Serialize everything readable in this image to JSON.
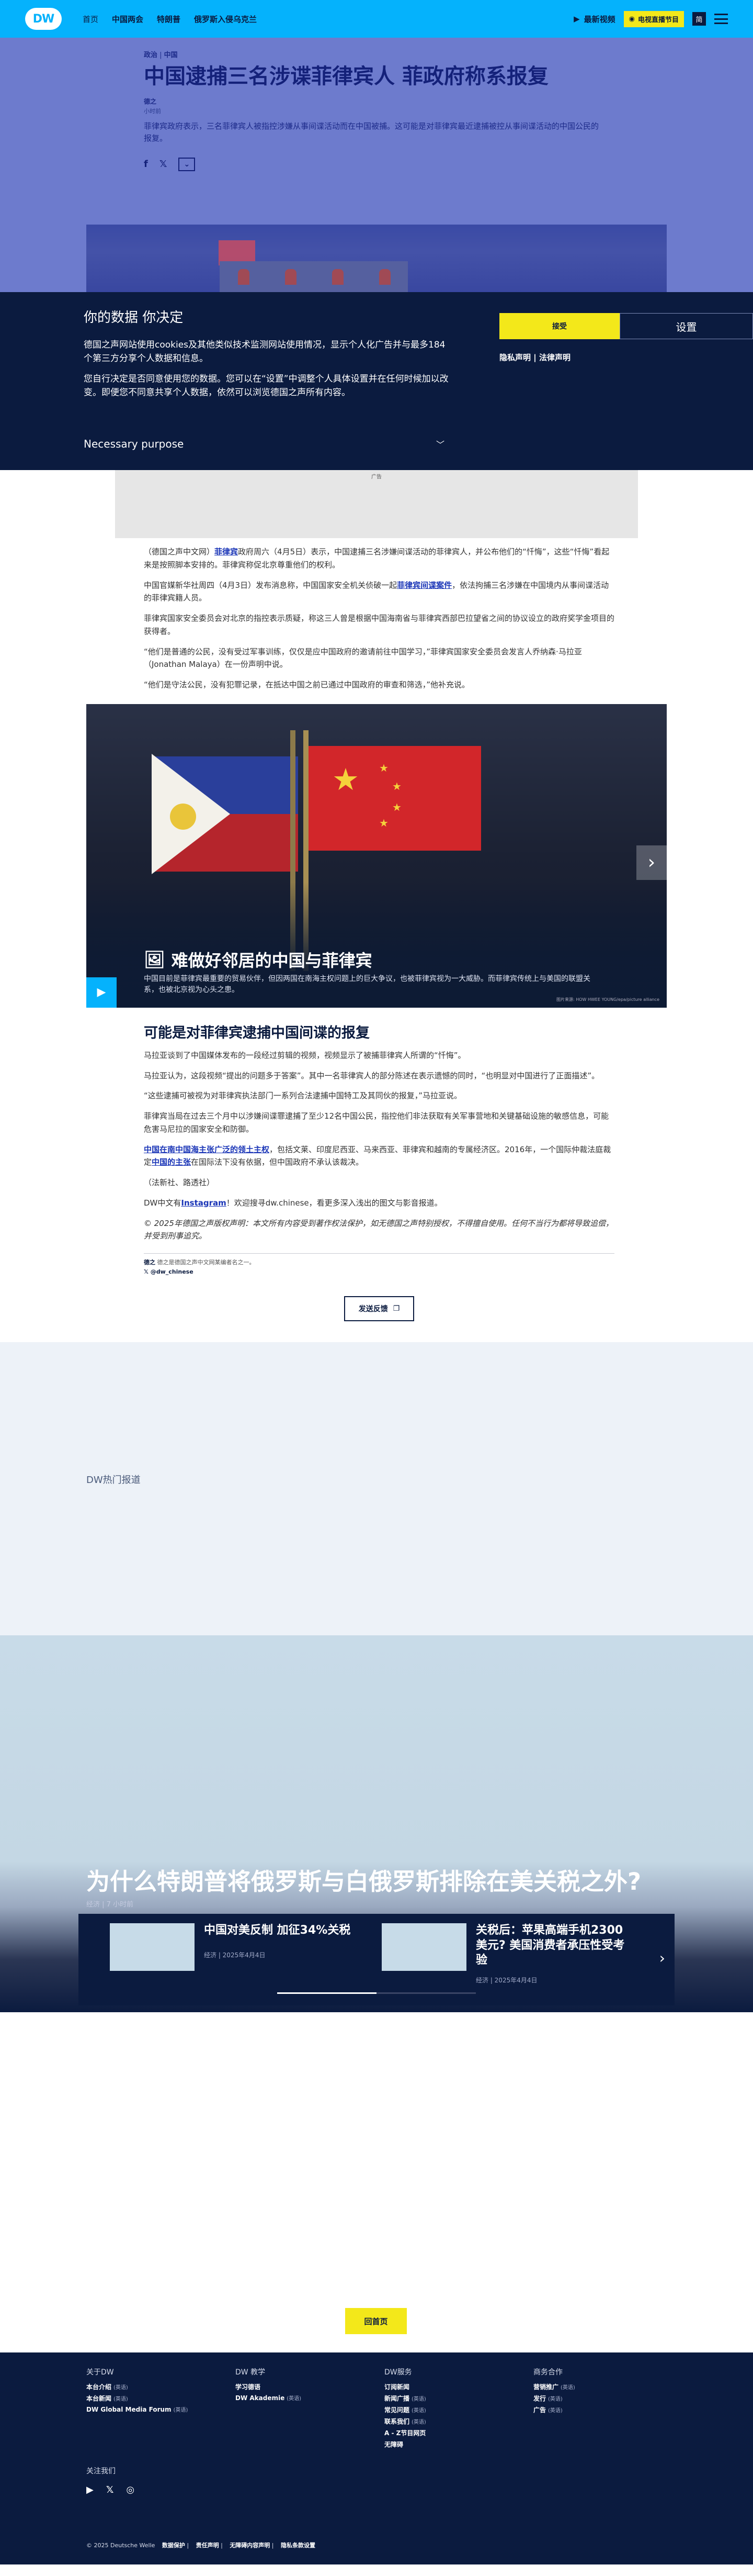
{
  "header": {
    "logo": "DW",
    "nav": [
      "首页",
      "中国两会",
      "特朗普",
      "俄罗斯入侵乌克兰"
    ],
    "live_label": "最新视频",
    "tv_label": "电视直播节目",
    "lang_label": "简"
  },
  "article": {
    "kicker_section": "政治",
    "kicker_topic": "中国",
    "headline": "中国逮捕三名涉谍菲律宾人 菲政府称系报复",
    "author": "德之",
    "time": "小时前",
    "lead": "菲律宾政府表示，三名菲律宾人被指控涉嫌从事间谍活动而在中国被捕。这可能是对菲律宾最近逮捕被控从事间谍活动的中国公民的报复。",
    "share": [
      "f",
      "𝕏",
      "⌄"
    ]
  },
  "cookie": {
    "title": "你的数据 你决定",
    "p1": "德国之声网站使用cookies及其他类似技术监测网站使用情况，显示个人化广告并与最多184 个第三方分享个人数据和信息。",
    "p2": "您自行决定是否同意使用您的数据。您可以在“设置”中调整个人具体设置并在任何时候加以改变。即便您不同意共享个人数据，依然可以浏览德国之声所有内容。",
    "purpose": "Necessary purpose",
    "accept": "接受",
    "settings": "设置",
    "privacy": "隐私声明",
    "legal": "法律声明"
  },
  "ad_label": "广告",
  "body": {
    "p1a": "（德国之声中文网）",
    "p1link": "菲律宾",
    "p1b": "政府周六（4月5日）表示，中国逮捕三名涉嫌间谍活动的菲律宾人，并公布他们的“忏悔”，这些“忏悔”看起来是按照脚本安排的。菲律宾称促北京尊重他们的权利。",
    "p2a": "中国官媒新华社周四（4月3日）发布消息称，中国国家安全机关侦破一起",
    "p2link": "菲律宾间谍案件",
    "p2b": "，依法拘捕三名涉嫌在中国境内从事间谍活动的菲律宾籍人员。",
    "p3": "菲律宾国家安全委员会对北京的指控表示质疑，称这三人曾是根据中国海南省与菲律宾西部巴拉望省之间的协议设立的政府奖学金项目的获得者。",
    "p4": "“他们是普通的公民，没有受过军事训练，仅仅是应中国政府的邀请前往中国学习，”菲律宾国家安全委员会发言人乔纳森·马拉亚（Jonathan Malaya）在一份声明中说。",
    "p5": "“他们是守法公民，没有犯罪记录，在抵达中国之前已通过中国政府的审查和筛选，”他补充说。",
    "h2": "可能是对菲律宾逮捕中国间谍的报复",
    "p6": "马拉亚谈到了中国媒体发布的一段经过剪辑的视频，视频显示了被捕菲律宾人所谓的“忏悔”。",
    "p7": "马拉亚认为，这段视频“提出的问题多于答案”。其中一名菲律宾人的部分陈述在表示遗憾的同时，“也明显对中国进行了正面描述”。",
    "p8": "“这些逮捕可被视为对菲律宾执法部门一系列合法逮捕中国特工及其同伙的报复，”马拉亚说。",
    "p9": "菲律宾当局在过去三个月中以涉嫌间谍罪逮捕了至少12名中国公民，指控他们非法获取有关军事营地和关键基础设施的敏感信息，可能危害马尼拉的国家安全和防御。",
    "p10link1": "中国在南中国海主张广泛的领土主权",
    "p10a": "，包括文莱、印度尼西亚、马来西亚、菲律宾和越南的专属经济区。2016年，一个国际仲裁法庭裁定",
    "p10link2": "中国的主张",
    "p10b": "在国际法下没有依据，但中国政府不承认该裁决。",
    "source": "（法新社、路透社）",
    "follow_a": "DW中文有",
    "follow_link": "Instagram",
    "follow_b": "！欢迎搜寻dw.chinese，看更多深入浅出的图文与影音报道。",
    "copyright": "© 2025年德国之声版权声明：本文所有内容受到著作权法保护，如无德国之声特别授权，不得擅自使用。任何不当行为都将导致追偿，并受到刑事追究。",
    "byline_name": "德之",
    "byline_desc": "德之是德国之声中文网某编者名之一。",
    "handle": "@dw_chinese",
    "feedback": "发送反馈"
  },
  "gallery": {
    "title": "难做好邻居的中国与菲律宾",
    "desc": "中国目前是菲律宾最重要的贸易伙伴，但因两国在南海主权问题上的巨大争议，也被菲律宾视为一大威胁。而菲律宾传统上与美国的联盟关系，也被北京视为心头之患。",
    "credit": "图片来源: HOW HWEE YOUNG/epa/picture alliance"
  },
  "hot": {
    "label": "DW热门报道",
    "feature_title": "为什么特朗普将俄罗斯与白俄罗斯排除在美关税之外?",
    "feature_meta": "经济 | 7 小时前",
    "cards": [
      {
        "title": "中国对美反制 加征34%关税",
        "meta": "经济 | 2025年4月4日"
      },
      {
        "title": "关税后：苹果高端手机2300美元? 美国消费者承压性受考验",
        "meta": "经济 | 2025年4月4日"
      }
    ]
  },
  "home_btn": "回首页",
  "footer": {
    "cols": [
      {
        "title": "关于DW",
        "items": [
          [
            "本台介绍",
            "(英语)"
          ],
          [
            "本台新闻",
            "(英语)"
          ],
          [
            "DW Global Media Forum",
            "(英语)"
          ]
        ]
      },
      {
        "title": "DW 教学",
        "items": [
          [
            "学习德语",
            ""
          ],
          [
            "DW Akademie",
            "(英语)"
          ]
        ]
      },
      {
        "title": "DW服务",
        "items": [
          [
            "订阅新闻",
            ""
          ],
          [
            "新闻广播",
            "(英语)"
          ],
          [
            "常见问题",
            "(英语)"
          ],
          [
            "联系我们",
            "(英语)"
          ],
          [
            "A - Z节目网页",
            ""
          ],
          [
            "无障碍",
            ""
          ]
        ]
      },
      {
        "title": "商务合作",
        "items": [
          [
            "营销推广",
            "(英语)"
          ],
          [
            "发行",
            "(英语)"
          ],
          [
            "广告",
            "(英语)"
          ]
        ]
      }
    ],
    "follow": "关注我们",
    "legal": "© 2025 Deutsche Welle",
    "legal_links": [
      "数据保护",
      "责任声明",
      "无障碍内容声明",
      "隐私条款设置"
    ]
  }
}
